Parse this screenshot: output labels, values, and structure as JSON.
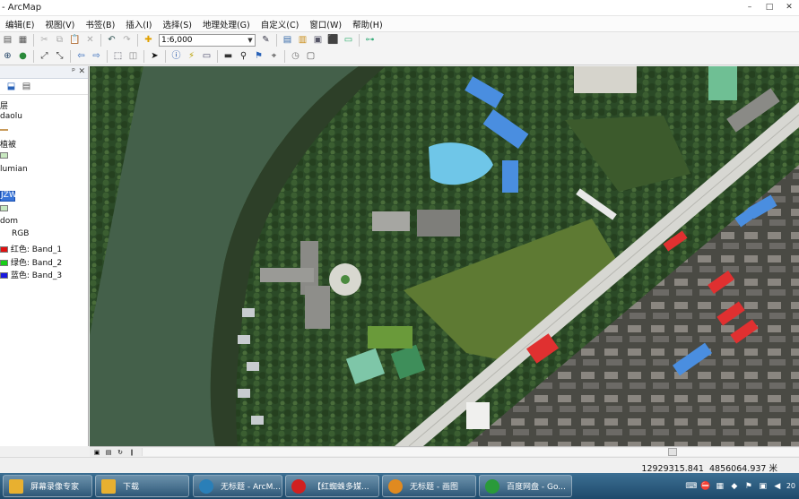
{
  "window": {
    "title": "- ArcMap",
    "controls": {
      "minimize": "–",
      "maximize": "□",
      "close": "✕"
    }
  },
  "menu": [
    "编辑(E)",
    "视图(V)",
    "书签(B)",
    "插入(I)",
    "选择(S)",
    "地理处理(G)",
    "自定义(C)",
    "窗口(W)",
    "帮助(H)"
  ],
  "toolbar": {
    "scale_value": "1:6,000",
    "icons_row1": [
      {
        "name": "save-icon",
        "glyph": "▤",
        "color": "#555"
      },
      {
        "name": "print-icon",
        "glyph": "▦",
        "color": "#555"
      },
      {
        "name": "cut-icon",
        "glyph": "✂",
        "color": "#aaa"
      },
      {
        "name": "copy-icon",
        "glyph": "⧉",
        "color": "#aaa"
      },
      {
        "name": "paste-icon",
        "glyph": "📋",
        "color": "#8a6"
      },
      {
        "name": "delete-icon",
        "glyph": "✕",
        "color": "#aaa"
      },
      {
        "name": "undo-icon",
        "glyph": "↶",
        "color": "#355"
      },
      {
        "name": "redo-icon",
        "glyph": "↷",
        "color": "#aaa"
      },
      {
        "name": "add-data-icon",
        "glyph": "✚",
        "color": "#e0a000"
      }
    ],
    "icons_row1_right": [
      {
        "name": "editor-toolbar-icon",
        "glyph": "✎",
        "color": "#334"
      },
      {
        "name": "table-of-contents-icon",
        "glyph": "▤",
        "color": "#3569a8"
      },
      {
        "name": "catalog-icon",
        "glyph": "▥",
        "color": "#c98b15"
      },
      {
        "name": "search-window-icon",
        "glyph": "▣",
        "color": "#556"
      },
      {
        "name": "arctoolbox-icon",
        "glyph": "⬛",
        "color": "#b22"
      },
      {
        "name": "python-window-icon",
        "glyph": "▭",
        "color": "#2a6"
      },
      {
        "name": "model-builder-icon",
        "glyph": "⊶",
        "color": "#3a7"
      }
    ],
    "icons_row2": [
      {
        "name": "zoom-in-icon",
        "glyph": "⊕",
        "color": "#246"
      },
      {
        "name": "globe-icon",
        "glyph": "●",
        "color": "#2a8a3a"
      },
      {
        "name": "fixed-zoom-in-icon",
        "glyph": "⤢",
        "color": "#333"
      },
      {
        "name": "fixed-zoom-out-icon",
        "glyph": "⤡",
        "color": "#333"
      },
      {
        "name": "back-extent-icon",
        "glyph": "⇦",
        "color": "#2a63b8"
      },
      {
        "name": "forward-extent-icon",
        "glyph": "⇨",
        "color": "#2a63b8"
      },
      {
        "name": "select-features-icon",
        "glyph": "⬚",
        "color": "#334"
      },
      {
        "name": "clear-selection-icon",
        "glyph": "◫",
        "color": "#888"
      },
      {
        "name": "select-elements-icon",
        "glyph": "➤",
        "color": "#111"
      },
      {
        "name": "identify-icon",
        "glyph": "ⓘ",
        "color": "#1b4fa8"
      },
      {
        "name": "hyperlink-icon",
        "glyph": "⚡",
        "color": "#b8a000"
      },
      {
        "name": "html-popup-icon",
        "glyph": "▭",
        "color": "#446"
      },
      {
        "name": "measure-icon",
        "glyph": "▬",
        "color": "#333"
      },
      {
        "name": "find-icon",
        "glyph": "⚲",
        "color": "#222"
      },
      {
        "name": "find-route-icon",
        "glyph": "⚑",
        "color": "#2a63b8"
      },
      {
        "name": "go-to-xy-icon",
        "glyph": "⌖",
        "color": "#333"
      },
      {
        "name": "time-slider-icon",
        "glyph": "◷",
        "color": "#777"
      },
      {
        "name": "create-viewer-icon",
        "glyph": "▢",
        "color": "#555"
      }
    ]
  },
  "toc": {
    "rows": [
      {
        "text": "层",
        "sw": "none"
      },
      {
        "text": "daolu",
        "sw": "none"
      },
      {
        "text": "",
        "sw": "line"
      },
      {
        "text": "植被",
        "sw": "none"
      },
      {
        "text": "",
        "sw": "green"
      },
      {
        "text": "lumian",
        "sw": "none"
      },
      {
        "text": "JZW",
        "sw": "selected"
      },
      {
        "text": "",
        "sw": "green"
      },
      {
        "text": "dom",
        "sw": "none"
      },
      {
        "text": "RGB",
        "sw": "none"
      },
      {
        "text": "红色:   Band_1",
        "sw": "red"
      },
      {
        "text": "绿色:  Band_2",
        "sw": "lime"
      },
      {
        "text": "蓝色:   Band_3",
        "sw": "blue"
      }
    ],
    "swatch_colors": {
      "green": "#c8e8c0",
      "selected": "#3874d8",
      "red": "#e01010",
      "lime": "#18d018",
      "blue": "#1818e0"
    }
  },
  "status": {
    "x": "12929315.841",
    "y": "4856064.937",
    "unit": "米"
  },
  "taskbar": {
    "items": [
      {
        "label": "屏幕录像专家",
        "icon": "folder-icon",
        "color": "#e8b030"
      },
      {
        "label": "下载",
        "icon": "folder-icon",
        "color": "#e8b030"
      },
      {
        "label": "无标题 - ArcM...",
        "icon": "arcmap-icon",
        "color": "#2a7fb8"
      },
      {
        "label": "【红蜘蛛多媒...",
        "icon": "red-spider-icon",
        "color": "#d02020"
      },
      {
        "label": "无标题 - 画图",
        "icon": "paint-icon",
        "color": "#e08a20"
      },
      {
        "label": "百度网盘 - Go...",
        "icon": "chrome-icon",
        "color": "#2a9a3a"
      }
    ],
    "tray_icons": [
      {
        "name": "keyboard-icon",
        "glyph": "⌨"
      },
      {
        "name": "stop-icon",
        "glyph": "⛔"
      },
      {
        "name": "network-icon",
        "glyph": "▦"
      },
      {
        "name": "shield-icon",
        "glyph": "◆"
      },
      {
        "name": "flag-icon",
        "glyph": "⚑"
      },
      {
        "name": "display-icon",
        "glyph": "▣"
      },
      {
        "name": "volume-icon",
        "glyph": "◀"
      }
    ],
    "clock_line1": "",
    "clock_line2": "20"
  },
  "map_legend_colors": {
    "water": "#4a6a52",
    "vegetation": "#2d4628",
    "road": "#d6d6d2",
    "building_gray": "#9a9a9a",
    "building_red": "#e03030",
    "building_blue": "#4a8ee0",
    "grass": "#6f8a3e"
  }
}
